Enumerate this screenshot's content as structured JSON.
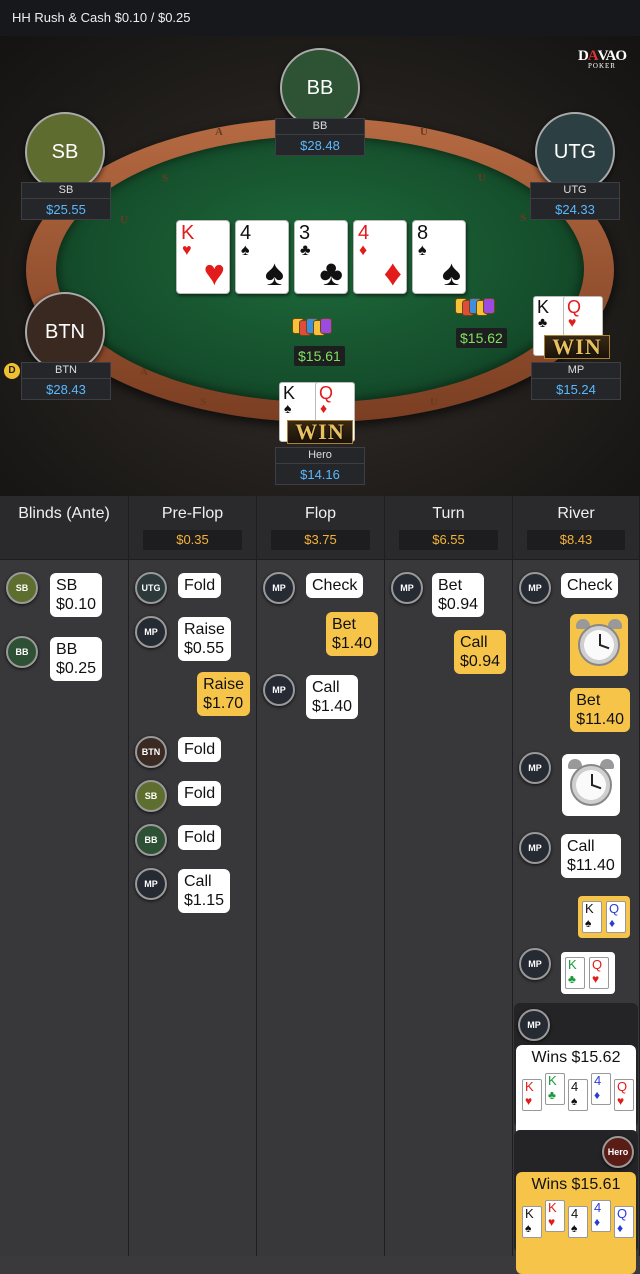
{
  "header": {
    "title": "HH  Rush & Cash $0.10 / $0.25"
  },
  "logo": {
    "line1_a": "D",
    "line1_b": "A",
    "line1_c": "VAO",
    "line2": "POKER"
  },
  "table": {
    "rail_letters": [
      "U",
      "S",
      "A",
      "S",
      "U",
      "U",
      "S",
      "A",
      "S",
      "U"
    ],
    "dealer_label": "D",
    "seats": [
      {
        "pos": "BB",
        "name": "BB",
        "stack": "$28.48",
        "color": "#2d5234"
      },
      {
        "pos": "SB",
        "name": "SB",
        "stack": "$25.55",
        "color": "#5e6c30"
      },
      {
        "pos": "UTG",
        "name": "UTG",
        "stack": "$24.33",
        "color": "#2c4044"
      },
      {
        "pos": "BTN",
        "name": "BTN",
        "stack": "$28.43",
        "color": "#3a2921"
      },
      {
        "name": "MP",
        "stack": "$15.24"
      },
      {
        "name": "Hero",
        "stack": "$14.16"
      }
    ],
    "board": [
      {
        "rank": "K",
        "suit": "♥",
        "color": "red"
      },
      {
        "rank": "4",
        "suit": "♠",
        "color": "blk"
      },
      {
        "rank": "3",
        "suit": "♣",
        "color": "blk"
      },
      {
        "rank": "4",
        "suit": "♦",
        "color": "red"
      },
      {
        "rank": "8",
        "suit": "♠",
        "color": "blk"
      }
    ],
    "pots": [
      "$15.61",
      "$15.62"
    ],
    "mp_cards": [
      {
        "rank": "K",
        "suit": "♣",
        "color": "blk"
      },
      {
        "rank": "Q",
        "suit": "♥",
        "color": "red"
      }
    ],
    "hero_cards": [
      {
        "rank": "K",
        "suit": "♠",
        "color": "blk"
      },
      {
        "rank": "Q",
        "suit": "♦",
        "color": "red"
      }
    ],
    "win_label": "WIN"
  },
  "history": {
    "columns": [
      {
        "title": "Blinds (Ante)",
        "pot": ""
      },
      {
        "title": "Pre-Flop",
        "pot": "$0.35"
      },
      {
        "title": "Flop",
        "pot": "$3.75"
      },
      {
        "title": "Turn",
        "pot": "$6.55"
      },
      {
        "title": "River",
        "pot": "$8.43"
      }
    ],
    "blinds": [
      {
        "pos": "SB",
        "text": "SB\n$0.10"
      },
      {
        "pos": "BB",
        "text": "BB\n$0.25"
      }
    ],
    "preflop": [
      {
        "pos": "UTG",
        "text": "Fold"
      },
      {
        "pos": "MP",
        "text": "Raise\n$0.55"
      },
      {
        "hero": true,
        "text": "Raise\n$1.70"
      },
      {
        "pos": "BTN",
        "text": "Fold"
      },
      {
        "pos": "SB",
        "text": "Fold"
      },
      {
        "pos": "BB",
        "text": "Fold"
      },
      {
        "pos": "MP",
        "text": "Call\n$1.15"
      }
    ],
    "flop": [
      {
        "pos": "MP",
        "text": "Check"
      },
      {
        "hero": true,
        "text": "Bet\n$1.40"
      },
      {
        "pos": "MP",
        "text": "Call\n$1.40"
      }
    ],
    "turn": [
      {
        "pos": "MP",
        "text": "Bet\n$0.94"
      },
      {
        "hero": true,
        "text": "Call\n$0.94"
      }
    ],
    "river": [
      {
        "pos": "MP",
        "text": "Check"
      },
      {
        "hero": true,
        "text": "Bet\n$11.40"
      },
      {
        "pos": "MP",
        "text": "Call\n$11.40"
      }
    ],
    "hero_show": [
      {
        "rank": "K",
        "suit": "♠",
        "color": "blk"
      },
      {
        "rank": "Q",
        "suit": "♦",
        "color": "blue"
      }
    ],
    "mp_show": [
      {
        "rank": "K",
        "suit": "♣",
        "color": "green"
      },
      {
        "rank": "Q",
        "suit": "♥",
        "color": "red"
      }
    ],
    "mp_wins": {
      "pos": "MP",
      "text": "Wins $15.62",
      "cards": [
        {
          "rank": "K",
          "suit": "♥",
          "color": "red"
        },
        {
          "rank": "K",
          "suit": "♣",
          "color": "green"
        },
        {
          "rank": "4",
          "suit": "♠",
          "color": "blk"
        },
        {
          "rank": "4",
          "suit": "♦",
          "color": "blue"
        },
        {
          "rank": "Q",
          "suit": "♥",
          "color": "red"
        }
      ]
    },
    "hero_wins": {
      "pos": "Hero",
      "text": "Wins $15.61",
      "cards": [
        {
          "rank": "K",
          "suit": "♠",
          "color": "blk"
        },
        {
          "rank": "K",
          "suit": "♥",
          "color": "red"
        },
        {
          "rank": "4",
          "suit": "♠",
          "color": "blk"
        },
        {
          "rank": "4",
          "suit": "♦",
          "color": "blue"
        },
        {
          "rank": "Q",
          "suit": "♦",
          "color": "blue"
        }
      ]
    }
  }
}
